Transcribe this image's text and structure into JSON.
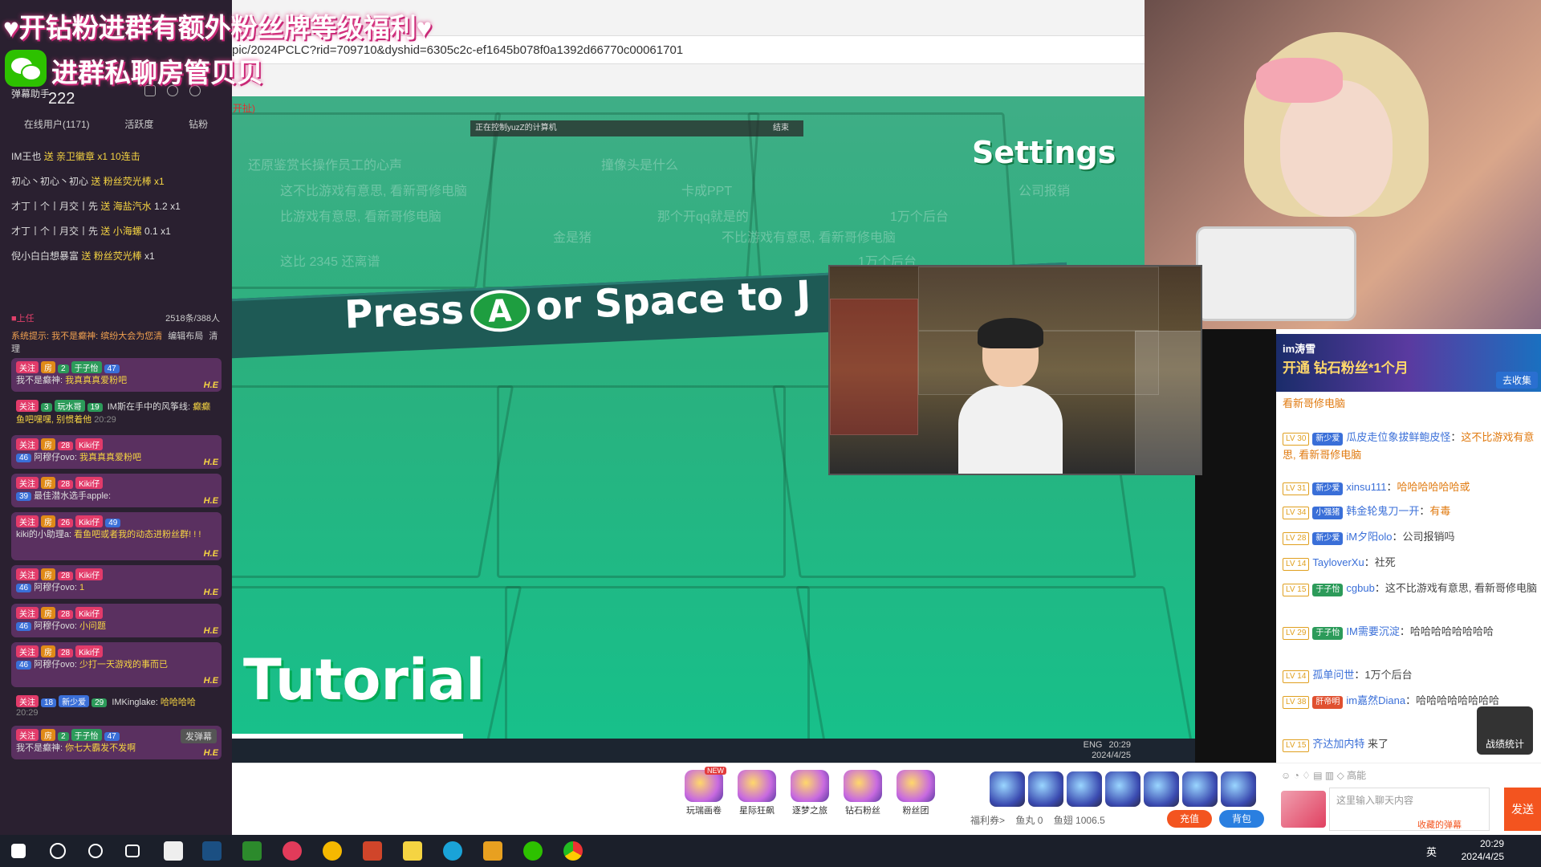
{
  "left_panel": {
    "banner_line1": "♥开钻粉进群有额外粉丝牌等级福利♥",
    "banner_line2": "进群私聊房管贝贝",
    "danmu_assistant": "弹幕助手",
    "count": "222",
    "tabs": [
      "在线用户(1171)",
      "活跃度",
      "钻粉"
    ],
    "gifts": [
      {
        "user": "IM王也",
        "action": "送 亲卫徽章",
        "count": "x1 10连击"
      },
      {
        "user": "初心丶初心丶初心",
        "action": "送 粉丝荧光棒",
        "count": "x1"
      },
      {
        "user": "才丁丨个丨月交丨先",
        "action": "送 海盐汽水",
        "count": "x1",
        "extra": "1.2"
      },
      {
        "user": "才丁丨个丨月交丨先",
        "action": "送 小海螺",
        "count": "x1",
        "extra": "0.1"
      },
      {
        "user": "倪小白白想暴富",
        "action": "送 粉丝荧光棒",
        "count": "x1"
      }
    ],
    "sep_left": "■上任",
    "sep_right": "2518条/388人",
    "edit_layout": "编辑布局",
    "clear": "清理",
    "system_notice": "系统提示: 我不是癫神: 缤纷大会为您清",
    "send_danmu": "发弹幕",
    "messages": [
      {
        "tags": [
          "关注",
          "房",
          "2",
          "于子怡",
          "47"
        ],
        "user": "我不是癫神",
        "text": "我真真真爱粉吧",
        "he": "H.E"
      },
      {
        "tags": [
          "关注",
          "3",
          "玩水哥",
          "19"
        ],
        "user": "IM斯在手中的风筝线",
        "text": "癫癫鱼吧嘿嘿, 别惯着他",
        "time": "20:29",
        "he": ""
      },
      {
        "tags": [
          "关注",
          "房",
          "28",
          "Kiki仔",
          "46"
        ],
        "user": "阿穆仔ovo",
        "text": "我真真真爱粉吧",
        "he": "H.E"
      },
      {
        "tags": [
          "关注",
          "房",
          "28",
          "Kiki仔",
          "39"
        ],
        "user": "最佳潜水选手apple",
        "text": "",
        "he": "H.E"
      },
      {
        "tags": [
          "关注",
          "房",
          "26",
          "Kiki仔",
          "49"
        ],
        "user": "kiki的小助理a",
        "text": "看鱼吧或者我的动态进粉丝群! ! !",
        "he": "H.E"
      },
      {
        "tags": [
          "关注",
          "房",
          "28",
          "Kiki仔",
          "46"
        ],
        "user": "阿穆仔ovo",
        "text": "1",
        "he": "H.E"
      },
      {
        "tags": [
          "关注",
          "房",
          "28",
          "Kiki仔",
          "46"
        ],
        "user": "阿穆仔ovo",
        "text": "小问题",
        "he": "H.E"
      },
      {
        "tags": [
          "关注",
          "房",
          "28",
          "Kiki仔",
          "46"
        ],
        "user": "阿穆仔ovo",
        "text": "少打一天游戏的事而已",
        "he": "H.E"
      },
      {
        "tags": [
          "关注",
          "18",
          "新少爱",
          "29"
        ],
        "user": "IMKinglake",
        "text": "哈哈哈哈",
        "time": "20:29",
        "he": ""
      },
      {
        "tags": [
          "关注",
          "房",
          "2",
          "于子怡",
          "47"
        ],
        "user": "我不是癫神",
        "text": "你七大霸发不发啊",
        "he": "H.E"
      }
    ]
  },
  "browser": {
    "url": "pic/2024PCLC?rid=709710&dyshid=6305c2c-ef1645b078f0a1392d66770c00061701",
    "red_note": "开扯)"
  },
  "remote_bar": {
    "label": "正在控制yuzZ的计算机",
    "end": "结束"
  },
  "game": {
    "settings": "Settings",
    "press_prefix": "Press",
    "press_button": "A",
    "press_suffix": "or Space to J",
    "tutorial": "Tutorial",
    "faded_danmu": [
      "还原鉴赏长操作员工的心声",
      "这不比游戏有意思, 看新哥修电脑",
      "比游戏有意思, 看新哥修电脑",
      "那个开qq就是的",
      "这比 2345 还离谱",
      "1万个后台",
      "不比游戏有意思, 看新哥修电脑",
      "撞像头是什么",
      "卡成PPT",
      "金是猪",
      "1万个后台",
      "公司报销"
    ],
    "inner_taskbar_time": "20:29",
    "inner_taskbar_date": "2024/4/25",
    "inner_taskbar_lang": "ENG"
  },
  "right_chat": {
    "promo_line1": "im涛雪",
    "promo_line2": "开通 钻石粉丝*1个月",
    "collect": "去收集",
    "first_line": "看新哥修电脑",
    "messages": [
      {
        "lv": "LV 30",
        "fan": "新少爱",
        "fan_lv": "16",
        "user": "瓜皮走位象拔鲜鲍皮怪",
        "text": "这不比游戏有意思, 看新哥修电脑"
      },
      {
        "lv": "LV 31",
        "fan": "新少爱",
        "fan_lv": "14",
        "user": "xinsu111",
        "text": "哈哈哈哈哈哈或"
      },
      {
        "lv": "LV 34",
        "fan": "小强猪",
        "fan_lv": "14",
        "user": "韩金轮鬼刀一开",
        "text": "有毒"
      },
      {
        "lv": "LV 28",
        "fan": "新少爱",
        "fan_lv": "19",
        "user": "iM夕阳olo",
        "text": "公司报销吗"
      },
      {
        "lv": "LV 14",
        "fan": "",
        "fan_lv": "",
        "user": "TayloverXu",
        "text": "社死"
      },
      {
        "lv": "LV 15",
        "fan": "于子怡",
        "fan_lv": "6",
        "user": "cgbub",
        "text": "这不比游戏有意思, 看新哥修电脑"
      },
      {
        "lv": "LV 29",
        "fan": "于子怡",
        "fan_lv": "8",
        "user": "IM需要沉淀",
        "text": "哈哈哈哈哈哈哈哈"
      },
      {
        "lv": "LV 14",
        "fan": "",
        "fan_lv": "",
        "user": "孤单问世",
        "text": "1万个后台"
      },
      {
        "lv": "LV 38",
        "fan": "肝帝明",
        "fan_lv": "21",
        "user": "im嘉然Diana",
        "text": "哈哈哈哈哈哈哈哈"
      },
      {
        "lv": "LV 15",
        "fan": "",
        "fan_lv": "",
        "user": "齐达加内特",
        "text": "来了"
      }
    ],
    "battle_report": "战绩统计",
    "input_placeholder": "这里输入聊天内容",
    "send": "发送",
    "collected_danmu": "收藏的弹幕",
    "quality": "高能"
  },
  "gift_bar": {
    "gifts": [
      {
        "label": "玩瑞画卷",
        "new": "NEW"
      },
      {
        "label": "星际狂飙",
        "new": ""
      },
      {
        "label": "逐梦之旅",
        "new": ""
      },
      {
        "label": "钻石粉丝",
        "new": ""
      },
      {
        "label": "粉丝团",
        "new": ""
      }
    ],
    "welfare": "福利券>",
    "fish_balls": "鱼丸 0",
    "fish_wings": "鱼翅 1006.5",
    "charge": "充值",
    "bag": "背包"
  },
  "taskbar": {
    "time": "20:29",
    "date": "2024/4/25",
    "ime": "英"
  }
}
